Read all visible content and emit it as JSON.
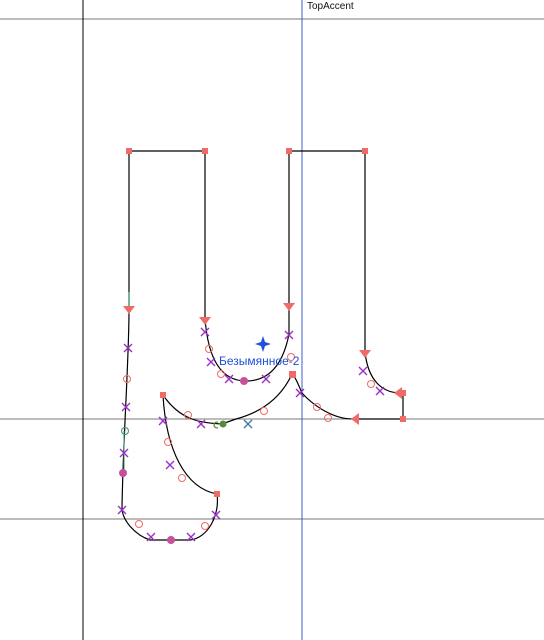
{
  "guides": {
    "vertical_guide_label": "TopAccent"
  },
  "anchor": {
    "label": "Безымянное-2",
    "marker_icon": "four-point-star-icon",
    "color": "#1f4fd6"
  },
  "colors": {
    "outline": "#000000",
    "guide_line": "#7a7a7a",
    "vertical_guide": "#3d5ccc",
    "control_x": "#9b30c8",
    "corner_point": "#f06a6a",
    "smooth_point": "#c8509a",
    "tangent_point": "#3aa08a"
  }
}
